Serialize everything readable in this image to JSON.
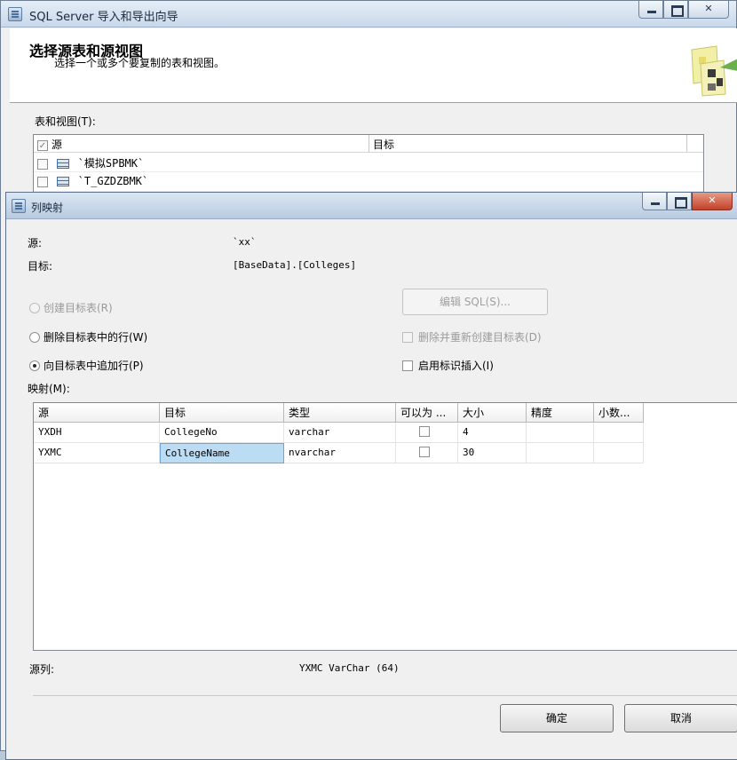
{
  "wizard": {
    "title": "SQL Server 导入和导出向导",
    "header_title": "选择源表和源视图",
    "header_subtitle": "选择一个或多个要复制的表和视图。",
    "tables_label": "表和视图(T):",
    "col_source": "源",
    "col_target": "目标",
    "rows": [
      {
        "source": "`模拟SPBMK`",
        "target": "",
        "checked": false
      },
      {
        "source": "`T_GZDZBMK`",
        "target": "",
        "checked": false
      }
    ]
  },
  "dialog": {
    "title": "列映射",
    "source_label": "源:",
    "source_value": "`xx`",
    "target_label": "目标:",
    "target_value": "[BaseData].[Colleges]",
    "opt_create": "创建目标表(R)",
    "opt_delete": "删除目标表中的行(W)",
    "opt_append": "向目标表中追加行(P)",
    "edit_sql": "编辑 SQL(S)...",
    "drop_recreate": "删除并重新创建目标表(D)",
    "identity_insert": "启用标识插入(I)",
    "mappings_label": "映射(M):",
    "columns": [
      "源",
      "目标",
      "类型",
      "可以为 ...",
      "大小",
      "精度",
      "小数..."
    ],
    "mapping_rows": [
      {
        "source": "YXDH",
        "target": "CollegeNo",
        "type": "varchar",
        "nullable": false,
        "size": "4",
        "precision": "",
        "scale": ""
      },
      {
        "source": "YXMC",
        "target": "CollegeName",
        "type": "nvarchar",
        "nullable": false,
        "size": "30",
        "precision": "",
        "scale": ""
      }
    ],
    "source_column_label": "源列:",
    "source_column_value": "YXMC VarChar (64)",
    "ok": "确定",
    "cancel": "取消"
  },
  "colors": {
    "selected_cell": "#bcdcf4",
    "title_bar": "#c9d8ea",
    "close_button": "#c2412a"
  }
}
